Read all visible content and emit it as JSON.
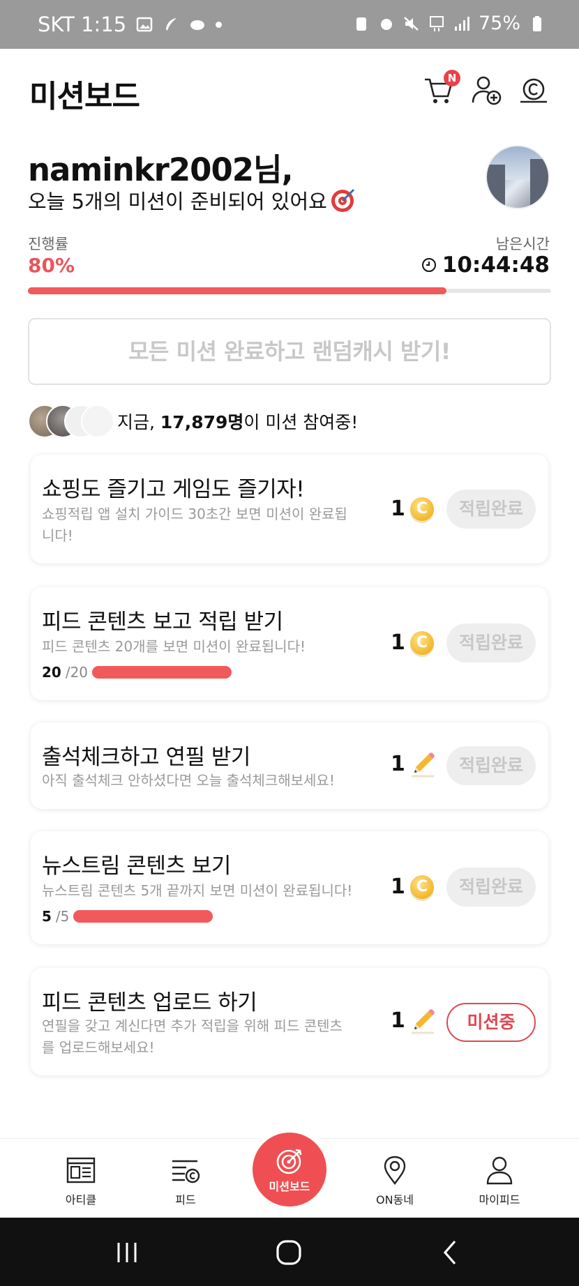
{
  "status_bar": {
    "carrier_time": "SKT 1:15",
    "battery": "75%"
  },
  "header": {
    "title": "미션보드",
    "cart_badge": "N"
  },
  "greeting": {
    "name": "naminkr2002님,",
    "message": "오늘 5개의 미션이 준비되어 있어요"
  },
  "progress": {
    "label": "진행률",
    "value_text": "80%",
    "value": 0.8,
    "time_label": "남은시간",
    "time_value": "10:44:48"
  },
  "reward_button": {
    "label": "모든 미션 완료하고 랜덤캐시 받기!"
  },
  "participants": {
    "prefix": "지금, ",
    "count": "17,879명",
    "suffix": "이 미션 참여중!"
  },
  "missions": [
    {
      "title": "쇼핑도 즐기고 게임도 즐기자!",
      "desc": "쇼핑적립 앱 설치 가이드 30초간 보면 미션이 완료됩니다!",
      "reward": "1",
      "reward_icon": "coin-icon",
      "state": "적립완료"
    },
    {
      "title": "피드 콘텐츠 보고 적립 받기",
      "desc": "피드 콘텐츠 20개를 보면 미션이 완료됩니다!",
      "progress_done": "20",
      "progress_total": "/20",
      "progress_value": 1.0,
      "reward": "1",
      "reward_icon": "coin-icon",
      "state": "적립완료"
    },
    {
      "title": "출석체크하고 연필 받기",
      "desc": "아직 출석체크 안하셨다면 오늘 출석체크해보세요!",
      "reward": "1",
      "reward_icon": "pencil-icon",
      "state": "적립완료"
    },
    {
      "title": "뉴스트림 콘텐츠 보기",
      "desc": "뉴스트림 콘텐츠 5개 끝까지 보면 미션이 완료됩니다!",
      "progress_done": "5",
      "progress_total": "/5",
      "progress_value": 1.0,
      "reward": "1",
      "reward_icon": "coin-icon",
      "state": "적립완료"
    },
    {
      "title": "피드 콘텐츠 업로드 하기",
      "desc": "연필을 갖고 계신다면 추가 적립을 위해 피드 콘텐츠를 업로드해보세요!",
      "reward": "1",
      "reward_icon": "pencil-icon",
      "state": "미션중"
    }
  ],
  "bottom_nav": {
    "items": [
      {
        "label": "아티클",
        "icon": "article-icon"
      },
      {
        "label": "피드",
        "icon": "feed-icon"
      },
      {
        "label": "미션보드",
        "icon": "target-icon"
      },
      {
        "label": "ON동네",
        "icon": "location-pin-icon"
      },
      {
        "label": "마이피드",
        "icon": "person-icon"
      }
    ]
  },
  "colors": {
    "accent": "#ef4f52",
    "progress": "#f05a5a",
    "muted": "#c8c8c8",
    "coin": "#f2b829"
  }
}
